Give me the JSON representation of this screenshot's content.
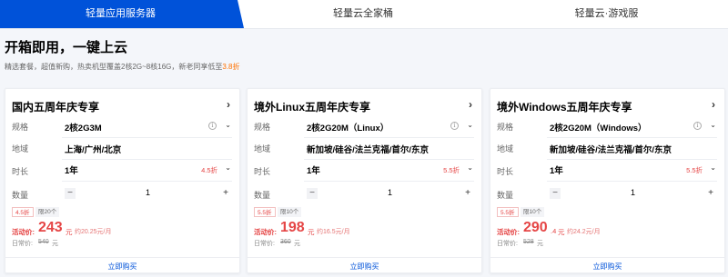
{
  "tabs": [
    {
      "label": "轻量应用服务器",
      "active": true
    },
    {
      "label": "轻量云全家桶",
      "active": false
    },
    {
      "label": "轻量云·游戏服",
      "active": false
    }
  ],
  "headline": "开箱即用，一键上云",
  "subline": {
    "text": "精选套餐，超值新购，热卖机型覆盖2核2G~8核16G，新老同享低至",
    "highlight": "3.8折"
  },
  "row_labels": {
    "spec": "规格",
    "region": "地域",
    "duration": "时长",
    "quantity": "数量"
  },
  "buy_label": "立即购买",
  "price_label": "活动价:",
  "orig_label": "日常价:",
  "icons": {
    "arrow": "chevron-right-icon",
    "info": "info-icon",
    "dropdown": "chevron-down-icon",
    "minus": "minus-icon",
    "plus": "plus-icon"
  },
  "colors": {
    "accent": "#0052d9",
    "price": "#e54545",
    "highlight": "#ff7200"
  },
  "cards": [
    {
      "title": "国内五周年庆专享",
      "spec": "2核2G3M",
      "region": "上海/广州/北京",
      "duration": "1年",
      "duration_badge": "4.5折",
      "quantity": "1",
      "tag_discount": "4.5折",
      "tag_limit": "限20个",
      "price": "243",
      "price_unit": "元",
      "price_per": "约20.25元/月",
      "orig_price": "540",
      "orig_unit": "元"
    },
    {
      "title": "境外Linux五周年庆专享",
      "spec": "2核2G20M（Linux）",
      "region": "新加坡/硅谷/法兰克福/首尔/东京",
      "duration": "1年",
      "duration_badge": "5.5折",
      "quantity": "1",
      "tag_discount": "5.5折",
      "tag_limit": "限10个",
      "price": "198",
      "price_unit": "元",
      "price_per": "约16.5元/月",
      "orig_price": "360",
      "orig_unit": "元"
    },
    {
      "title": "境外Windows五周年庆专享",
      "spec": "2核2G20M（Windows）",
      "region": "新加坡/硅谷/法兰克福/首尔/东京",
      "duration": "1年",
      "duration_badge": "5.5折",
      "quantity": "1",
      "tag_discount": "5.5折",
      "tag_limit": "限10个",
      "price": "290",
      "price_decimal": ".4",
      "price_unit": "元",
      "price_per": "约24.2元/月",
      "orig_price": "528",
      "orig_unit": "元"
    }
  ]
}
